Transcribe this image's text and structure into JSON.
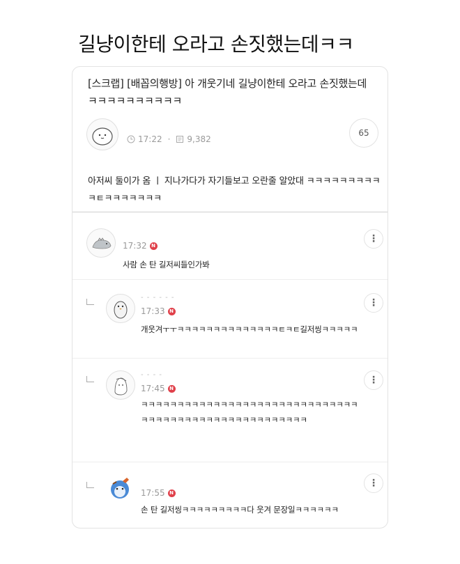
{
  "page_title": "길냥이한테 오라고 손짓했는데ㅋㅋ",
  "post": {
    "title": "[스크랩] [배꼽의행방] 아        개웃기네 길냥이한테 오라고 손짓했는데ㅋㅋㅋㅋㅋㅋㅋㅋㅋㅋ",
    "time": "17:22",
    "views": "9,382",
    "comment_count": "65",
    "body": "아저씨 둘이가 옴     ㅣ 지나가다가 자기들보고 오란줄 알았대 ㅋㅋㅋㅋㅋㅋㅋㅋㅋㅋㅌㅋㅋㅋㅋㅋㅋㅋ"
  },
  "comments": [
    {
      "time": "17:32",
      "nickname": "",
      "text": "사람 손 탄 길저씨들인가봐",
      "is_reply": false
    },
    {
      "time": "17:33",
      "nickname": "- - - - - -",
      "text": "개웃겨ㅜㅜㅋㅋㅋㅋㅋㅋㅋㅋㅋㅋㅋㅋㅋㅋㅌㅋㅌ길저씽ㅋㅋㅋㅋㅋ",
      "is_reply": true
    },
    {
      "time": "17:45",
      "nickname": "- - - -",
      "text": "ㅋㅋㅋㅋㅋㅋㅋㅋㅋㅋㅋㅋㅋㅋㅋㅋㅋㅋㅋㅋㅋㅋㅋㅋㅋㅋㅋㅋㅋㅋㅋㅋㅋㅋㅋㅋㅋㅋㅋㅋㅋㅋㅋㅋㅋㅋㅋㅋㅋㅋㅋㅋㅋ",
      "is_reply": true
    },
    {
      "time": "17:55",
      "nickname": "",
      "text": "손 탄 길저씽ㅋㅋㅋㅋㅋㅋㅋㅋㅋ다 웃겨 문장일ㅋㅋㅋㅋㅋㅋ",
      "is_reply": true
    }
  ],
  "badge_label": "N",
  "more_icon": "⋮",
  "colors": {
    "new_badge": "#e0404a",
    "meta_text": "#9a9a9a",
    "divider": "#cfcfcf"
  }
}
